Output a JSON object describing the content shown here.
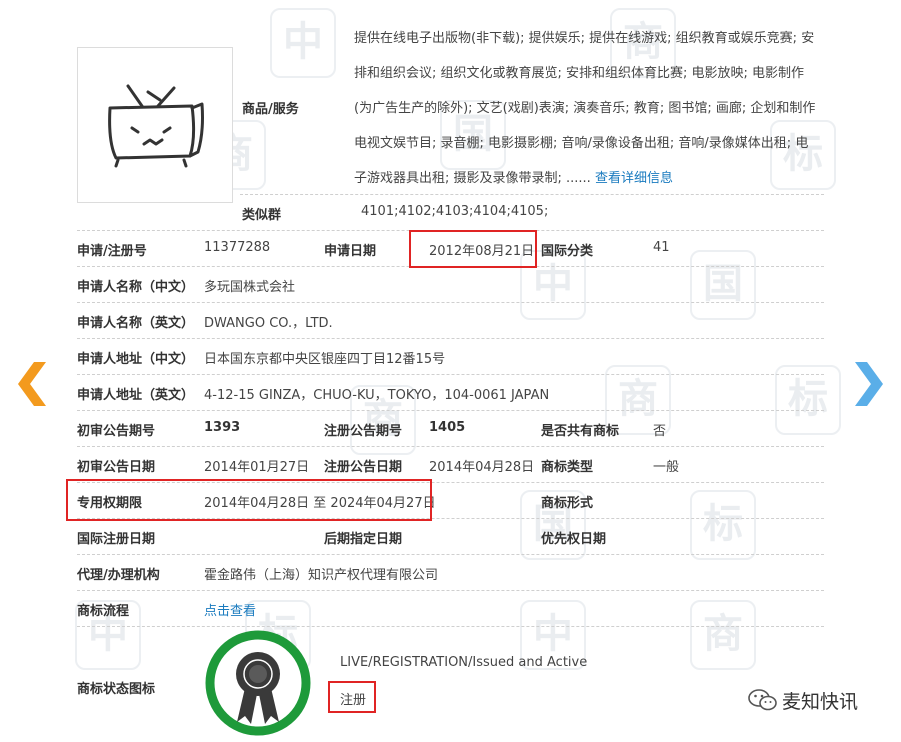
{
  "goods": {
    "label": "商品/服务",
    "text": "提供在线电子出版物(非下载); 提供娱乐; 提供在线游戏; 组织教育或娱乐竞赛; 安排和组织会议; 组织文化或教育展览; 安排和组织体育比赛; 电影放映; 电影制作(为广告生产的除外); 文艺(戏剧)表演; 演奏音乐; 教育; 图书馆; 画廊; 企划和制作电视文娱节目; 录音棚; 电影摄影棚; 音响/录像设备出租; 音响/录像媒体出租; 电子游戏器具出租; 摄影及录像带录制; ......",
    "detail_link": "查看详细信息"
  },
  "similar_group": {
    "label": "类似群",
    "value": "4101;4102;4103;4104;4105;"
  },
  "reg_no": {
    "label": "申请/注册号",
    "value": "11377288"
  },
  "apply_date": {
    "label": "申请日期",
    "value": "2012年08月21日"
  },
  "intl_class": {
    "label": "国际分类",
    "value": "41"
  },
  "applicant_cn": {
    "label": "申请人名称（中文）",
    "value": "多玩国株式会社"
  },
  "applicant_en": {
    "label": "申请人名称（英文）",
    "value": "DWANGO CO.，LTD."
  },
  "address_cn": {
    "label": "申请人地址（中文）",
    "value": "日本国东京都中央区银座四丁目12番15号"
  },
  "address_en": {
    "label": "申请人地址（英文）",
    "value": "4-12-15 GINZA，CHUO-KU，TOKYO，104-0061 JAPAN"
  },
  "prelim_no": {
    "label": "初审公告期号",
    "value": "1393"
  },
  "reg_notice_no": {
    "label": "注册公告期号",
    "value": "1405"
  },
  "shared": {
    "label": "是否共有商标",
    "value": "否"
  },
  "prelim_date": {
    "label": "初审公告日期",
    "value": "2014年01月27日"
  },
  "reg_notice_date": {
    "label": "注册公告日期",
    "value": "2014年04月28日"
  },
  "tm_type": {
    "label": "商标类型",
    "value": "一般"
  },
  "exclusive": {
    "label": "专用权期限",
    "value": "2014年04月28日 至 2024年04月27日"
  },
  "tm_form": {
    "label": "商标形式",
    "value": ""
  },
  "intl_reg_date": {
    "label": "国际注册日期",
    "value": ""
  },
  "later_date": {
    "label": "后期指定日期",
    "value": ""
  },
  "priority_date": {
    "label": "优先权日期",
    "value": ""
  },
  "agent": {
    "label": "代理/办理机构",
    "value": "霍金路伟（上海）知识产权代理有限公司"
  },
  "process": {
    "label": "商标流程",
    "value": "点击查看"
  },
  "status": {
    "label": "商标状态图标",
    "en": "LIVE/REGISTRATION/Issued and Active",
    "cn": "注册"
  },
  "watermark_chars": [
    "中",
    "国",
    "商",
    "标"
  ],
  "wechat_label": "麦知快讯",
  "icons": [
    "tv-logo-icon",
    "prev-arrow-icon",
    "next-arrow-icon",
    "award-badge-icon",
    "wechat-icon"
  ],
  "colors": {
    "accent_orange": "#f39a1e",
    "accent_blue": "#5aaee8",
    "highlight_red": "#e02424",
    "badge_green": "#1e9a3a",
    "link": "#1a7bbf"
  }
}
